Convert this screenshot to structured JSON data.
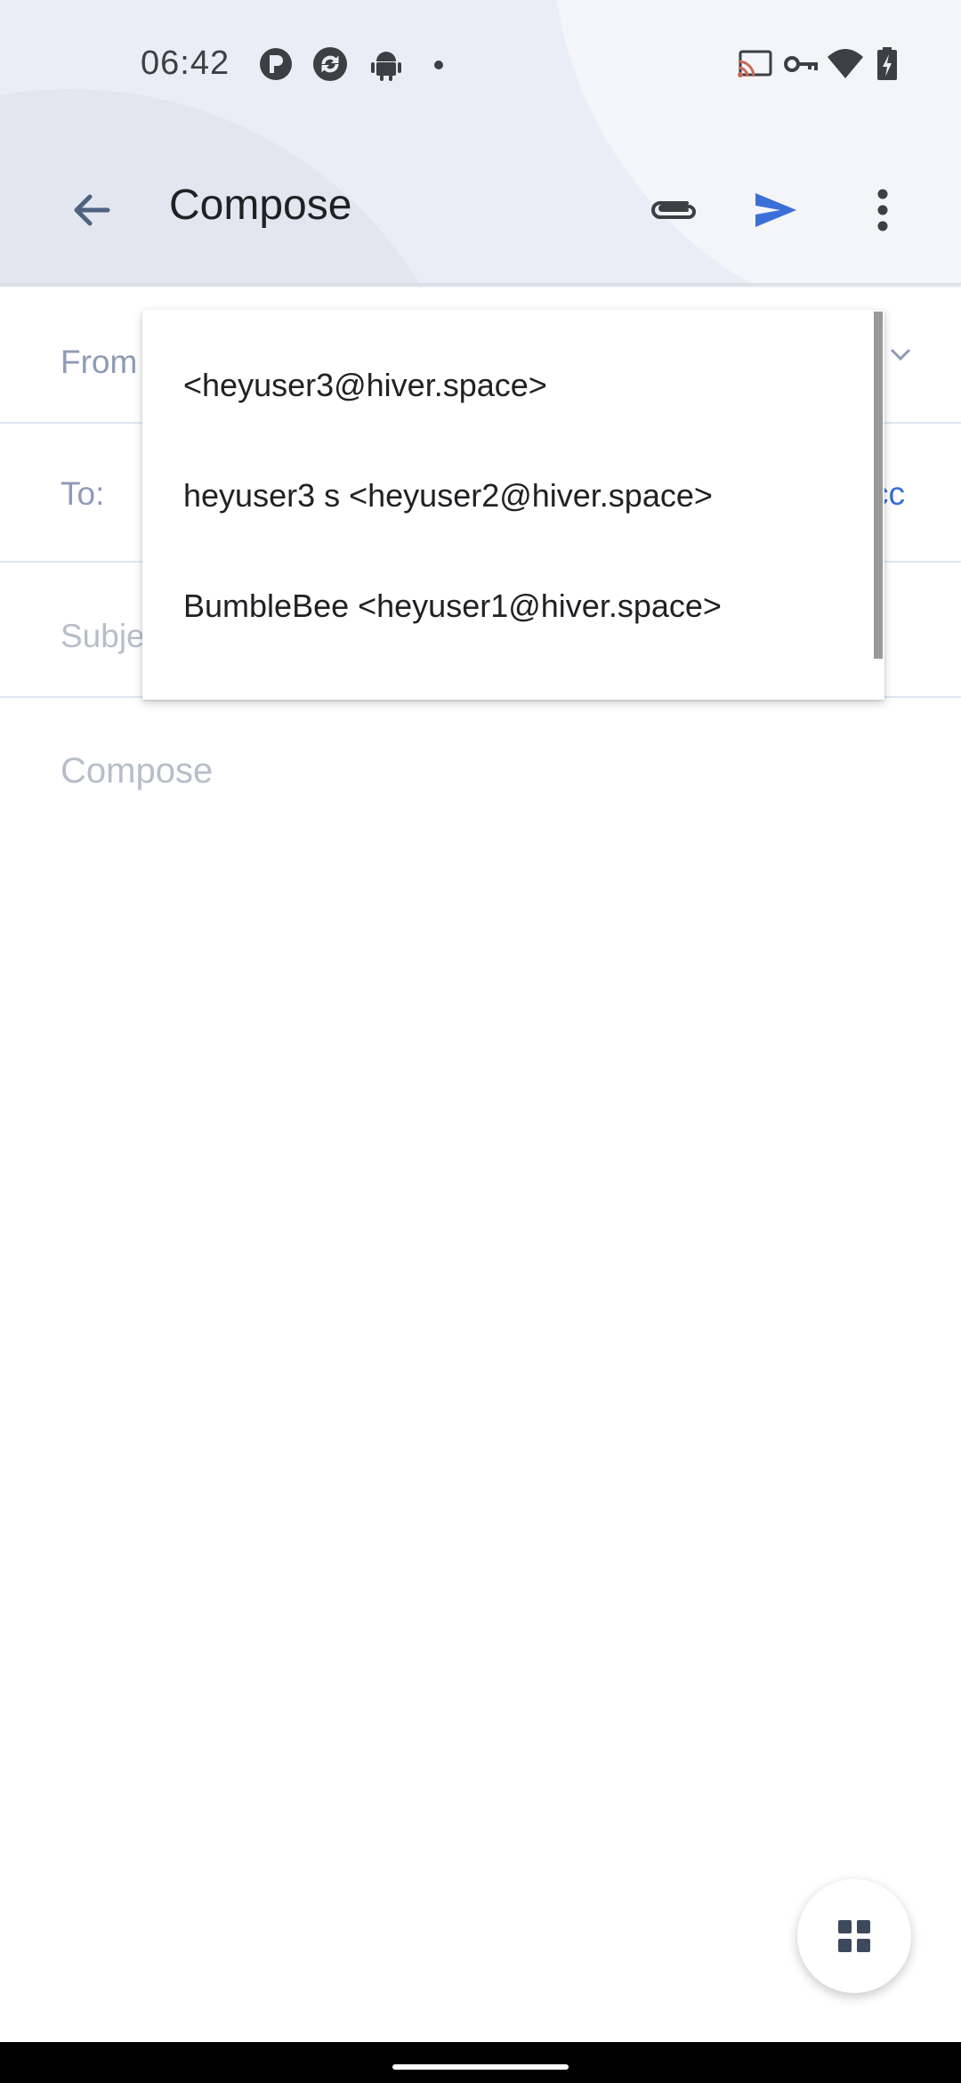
{
  "status_bar": {
    "time": "06:42",
    "icons": [
      "app-notification-icon",
      "sync-icon",
      "android-icon",
      "dot-icon",
      "cast-icon",
      "vpn-key-icon",
      "wifi-icon",
      "battery-charging-icon"
    ]
  },
  "app_bar": {
    "title": "Compose",
    "back_icon": "arrow-back-icon",
    "attach_icon": "paperclip-icon",
    "send_icon": "send-icon",
    "more_icon": "more-vert-icon"
  },
  "form": {
    "from_label": "From",
    "to_label": "To:",
    "cc_label": "cc",
    "subject_placeholder": "Subje",
    "body_placeholder": "Compose"
  },
  "from_dropdown": {
    "options": [
      "<heyuser3@hiver.space>",
      "heyuser3 s <heyuser2@hiver.space>",
      "BumbleBee <heyuser1@hiver.space>"
    ]
  },
  "fab": {
    "icon": "apps-grid-icon"
  },
  "colors": {
    "accent": "#3b6fd8",
    "header_bg": "#e9edf5",
    "label": "#8e9bb5"
  }
}
